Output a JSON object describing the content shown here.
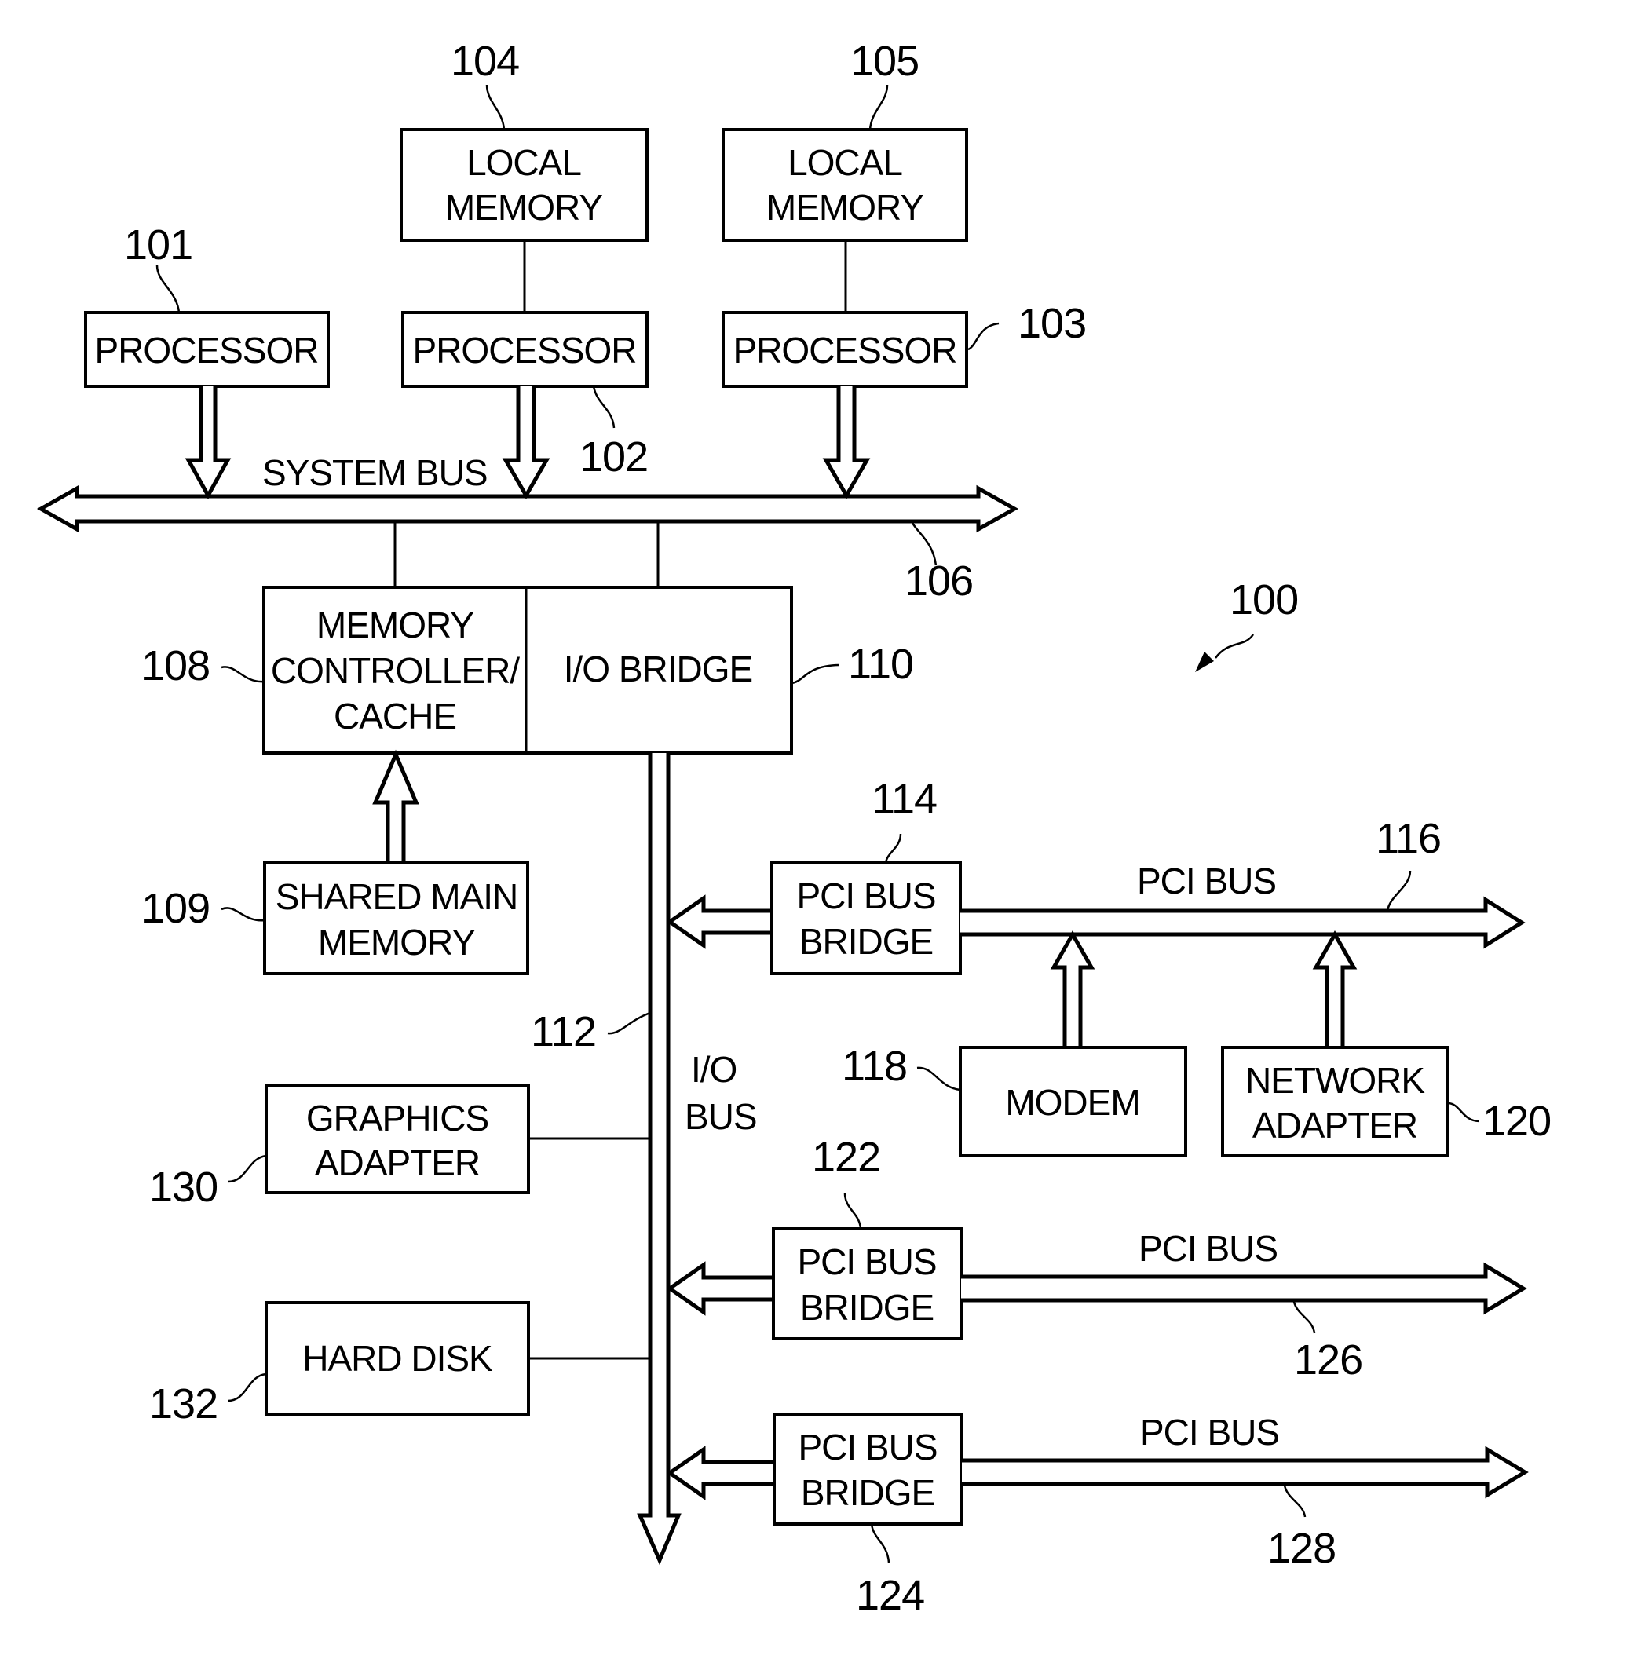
{
  "figure": {
    "ref": "100",
    "components": {
      "processor_101": {
        "lines": [
          "PROCESSOR"
        ],
        "ref": "101"
      },
      "processor_102": {
        "lines": [
          "PROCESSOR"
        ],
        "ref": "102"
      },
      "processor_103": {
        "lines": [
          "PROCESSOR"
        ],
        "ref": "103"
      },
      "local_memory_104": {
        "lines": [
          "LOCAL",
          "MEMORY"
        ],
        "ref": "104"
      },
      "local_memory_105": {
        "lines": [
          "LOCAL",
          "MEMORY"
        ],
        "ref": "105"
      },
      "memory_controller_108": {
        "lines": [
          "MEMORY",
          "CONTROLLER/",
          "CACHE"
        ],
        "ref": "108"
      },
      "io_bridge_110": {
        "lines": [
          "I/O BRIDGE"
        ],
        "ref": "110"
      },
      "shared_main_memory_109": {
        "lines": [
          "SHARED MAIN",
          "MEMORY"
        ],
        "ref": "109"
      },
      "graphics_adapter_130": {
        "lines": [
          "GRAPHICS",
          "ADAPTER"
        ],
        "ref": "130"
      },
      "hard_disk_132": {
        "lines": [
          "HARD DISK"
        ],
        "ref": "132"
      },
      "pci_bus_bridge_114": {
        "lines": [
          "PCI BUS",
          "BRIDGE"
        ],
        "ref": "114"
      },
      "modem_118": {
        "lines": [
          "MODEM"
        ],
        "ref": "118"
      },
      "network_adapter_120": {
        "lines": [
          "NETWORK",
          "ADAPTER"
        ],
        "ref": "120"
      },
      "pci_bus_bridge_122": {
        "lines": [
          "PCI BUS",
          "BRIDGE"
        ],
        "ref": "122"
      },
      "pci_bus_bridge_124": {
        "lines": [
          "PCI BUS",
          "BRIDGE"
        ],
        "ref": "124"
      }
    },
    "buses": {
      "system_bus_106": {
        "label": "SYSTEM BUS",
        "ref": "106"
      },
      "io_bus_112": {
        "lines": [
          "I/O",
          "BUS"
        ],
        "ref": "112"
      },
      "pci_bus_116": {
        "label": "PCI BUS",
        "ref": "116"
      },
      "pci_bus_126": {
        "label": "PCI BUS",
        "ref": "126"
      },
      "pci_bus_128": {
        "label": "PCI BUS",
        "ref": "128"
      }
    }
  }
}
